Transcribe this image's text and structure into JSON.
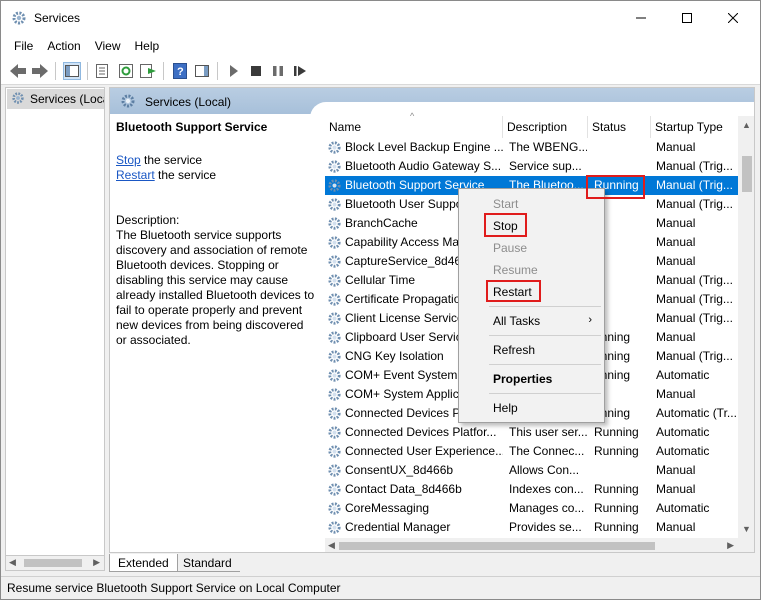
{
  "window": {
    "title": "Services"
  },
  "menubar": {
    "items": [
      "File",
      "Action",
      "View",
      "Help"
    ]
  },
  "toolbar": {
    "icons": [
      "back-arrow-icon",
      "forward-arrow-icon",
      "show-hide-tree-icon",
      "properties-icon",
      "refresh-icon",
      "export-list-icon",
      "help-icon",
      "show-hide-action-pane-icon",
      "start-service-icon",
      "stop-service-icon",
      "pause-service-icon",
      "restart-service-icon"
    ]
  },
  "tree": {
    "selected_item": "Services (Local)"
  },
  "main_header": {
    "title": "Services (Local)"
  },
  "description_panel": {
    "service_name": "Bluetooth Support Service",
    "stop_link": "Stop",
    "stop_suffix": " the service",
    "restart_link": "Restart",
    "restart_suffix": " the service",
    "description_label": "Description:",
    "description_text": "The Bluetooth service supports discovery and association of remote Bluetooth devices.  Stopping or disabling this service may cause already installed Bluetooth devices to fail to operate properly and prevent new devices from being discovered or associated."
  },
  "list": {
    "columns": [
      "Name",
      "Description",
      "Status",
      "Startup Type"
    ],
    "rows": [
      {
        "name": "Block Level Backup Engine ...",
        "description": "The WBENG...",
        "status": "",
        "startup": "Manual"
      },
      {
        "name": "Bluetooth Audio Gateway S...",
        "description": "Service sup...",
        "status": "",
        "startup": "Manual (Trig..."
      },
      {
        "name": "Bluetooth Support Service",
        "description": "The Bluetoo...",
        "status": "Running",
        "startup": "Manual (Trig...",
        "selected": true
      },
      {
        "name": "Bluetooth User Suppo",
        "description": "",
        "status": "",
        "startup": "Manual (Trig..."
      },
      {
        "name": "BranchCache",
        "description": "",
        "status": "",
        "startup": "Manual"
      },
      {
        "name": "Capability Access Ma",
        "description": "",
        "status": "",
        "startup": "Manual"
      },
      {
        "name": "CaptureService_8d466",
        "description": "",
        "status": "",
        "startup": "Manual"
      },
      {
        "name": "Cellular Time",
        "description": "",
        "status": "",
        "startup": "Manual (Trig..."
      },
      {
        "name": "Certificate Propagatio",
        "description": "",
        "status": "",
        "startup": "Manual (Trig..."
      },
      {
        "name": "Client License Service",
        "description": "",
        "status": "",
        "startup": "Manual (Trig..."
      },
      {
        "name": "Clipboard User Servic",
        "description": "",
        "status": "unning",
        "startup": "Manual"
      },
      {
        "name": "CNG Key Isolation",
        "description": "",
        "status": "unning",
        "startup": "Manual (Trig..."
      },
      {
        "name": "COM+ Event System",
        "description": "",
        "status": "unning",
        "startup": "Automatic"
      },
      {
        "name": "COM+ System Applic",
        "description": "",
        "status": "",
        "startup": "Manual"
      },
      {
        "name": "Connected Devices Pl",
        "description": "",
        "status": "unning",
        "startup": "Automatic (Tr..."
      },
      {
        "name": "Connected Devices Platfor...",
        "description": "This user ser...",
        "status": "Running",
        "startup": "Automatic"
      },
      {
        "name": "Connected User Experience...",
        "description": "The Connec...",
        "status": "Running",
        "startup": "Automatic"
      },
      {
        "name": "ConsentUX_8d466b",
        "description": "Allows Con...",
        "status": "",
        "startup": "Manual"
      },
      {
        "name": "Contact Data_8d466b",
        "description": "Indexes con...",
        "status": "Running",
        "startup": "Manual"
      },
      {
        "name": "CoreMessaging",
        "description": "Manages co...",
        "status": "Running",
        "startup": "Automatic"
      },
      {
        "name": "Credential Manager",
        "description": "Provides se...",
        "status": "Running",
        "startup": "Manual"
      }
    ]
  },
  "context_menu": {
    "items": [
      {
        "label": "Start",
        "state": "disabled"
      },
      {
        "label": "Stop",
        "state": "enabled",
        "highlight": true
      },
      {
        "label": "Pause",
        "state": "disabled"
      },
      {
        "label": "Resume",
        "state": "disabled"
      },
      {
        "label": "Restart",
        "state": "enabled",
        "highlight": true
      },
      {
        "label": "All Tasks",
        "state": "enabled",
        "submenu": true
      },
      {
        "label": "Refresh",
        "state": "enabled"
      },
      {
        "label": "Properties",
        "state": "enabled",
        "bold": true
      },
      {
        "label": "Help",
        "state": "enabled"
      }
    ],
    "submenu_arrow": "›"
  },
  "tabs": {
    "extended": "Extended",
    "standard": "Standard"
  },
  "statusbar": {
    "text": "Resume service Bluetooth Support Service on Local Computer"
  },
  "colors": {
    "selection": "#0078d7",
    "highlight_box": "#e01c1c",
    "link": "#1a57c4"
  }
}
